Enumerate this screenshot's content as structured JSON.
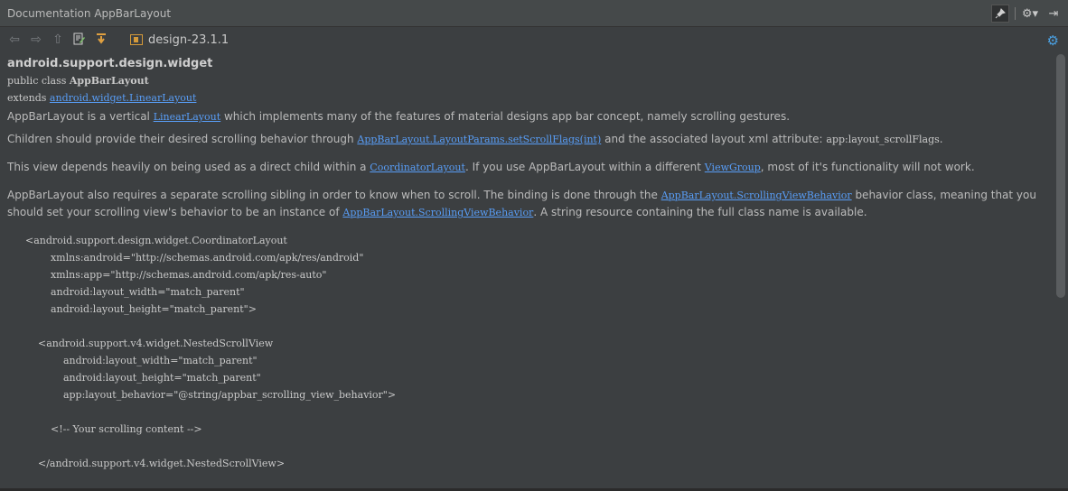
{
  "window": {
    "title": "Documentation AppBarLayout"
  },
  "titlebar_tools": {
    "pin": "pin-icon",
    "settings": "gear-icon",
    "hide": "hide-icon"
  },
  "toolbar": {
    "library": "design-23.1.1"
  },
  "doc": {
    "package": "android.support.design.widget",
    "decl_prefix": "public class ",
    "class_name": "AppBarLayout",
    "extends_label": "extends ",
    "extends_link": "android.widget.LinearLayout",
    "p1_a": "AppBarLayout is a vertical ",
    "p1_link": "LinearLayout",
    "p1_b": " which implements many of the features of material designs app bar concept, namely scrolling gestures.",
    "p2_a": "Children should provide their desired scrolling behavior through ",
    "p2_link": "AppBarLayout.LayoutParams.setScrollFlags(int)",
    "p2_b": " and the associated layout xml attribute: ",
    "p2_code": "app:layout_scrollFlags",
    "p2_c": ".",
    "p3_a": "This view depends heavily on being used as a direct child within a ",
    "p3_link1": "CoordinatorLayout",
    "p3_b": ". If you use AppBarLayout within a different ",
    "p3_link2": "ViewGroup",
    "p3_c": ", most of it's functionality will not work.",
    "p4_a": "AppBarLayout also requires a separate scrolling sibling in order to know when to scroll. The binding is done through the ",
    "p4_link1": "AppBarLayout.ScrollingViewBehavior",
    "p4_b": " behavior class, meaning that you should set your scrolling view's behavior to be an instance of ",
    "p4_link2": "AppBarLayout.ScrollingViewBehavior",
    "p4_c": ". A string resource containing the full class name is available.",
    "code": "<android.support.design.widget.CoordinatorLayout\n        xmlns:android=\"http://schemas.android.com/apk/res/android\"\n        xmlns:app=\"http://schemas.android.com/apk/res-auto\"\n        android:layout_width=\"match_parent\"\n        android:layout_height=\"match_parent\">\n\n    <android.support.v4.widget.NestedScrollView\n            android:layout_width=\"match_parent\"\n            android:layout_height=\"match_parent\"\n            app:layout_behavior=\"@string/appbar_scrolling_view_behavior\">\n\n        <!-- Your scrolling content -->\n\n    </android.support.v4.widget.NestedScrollView>"
  }
}
